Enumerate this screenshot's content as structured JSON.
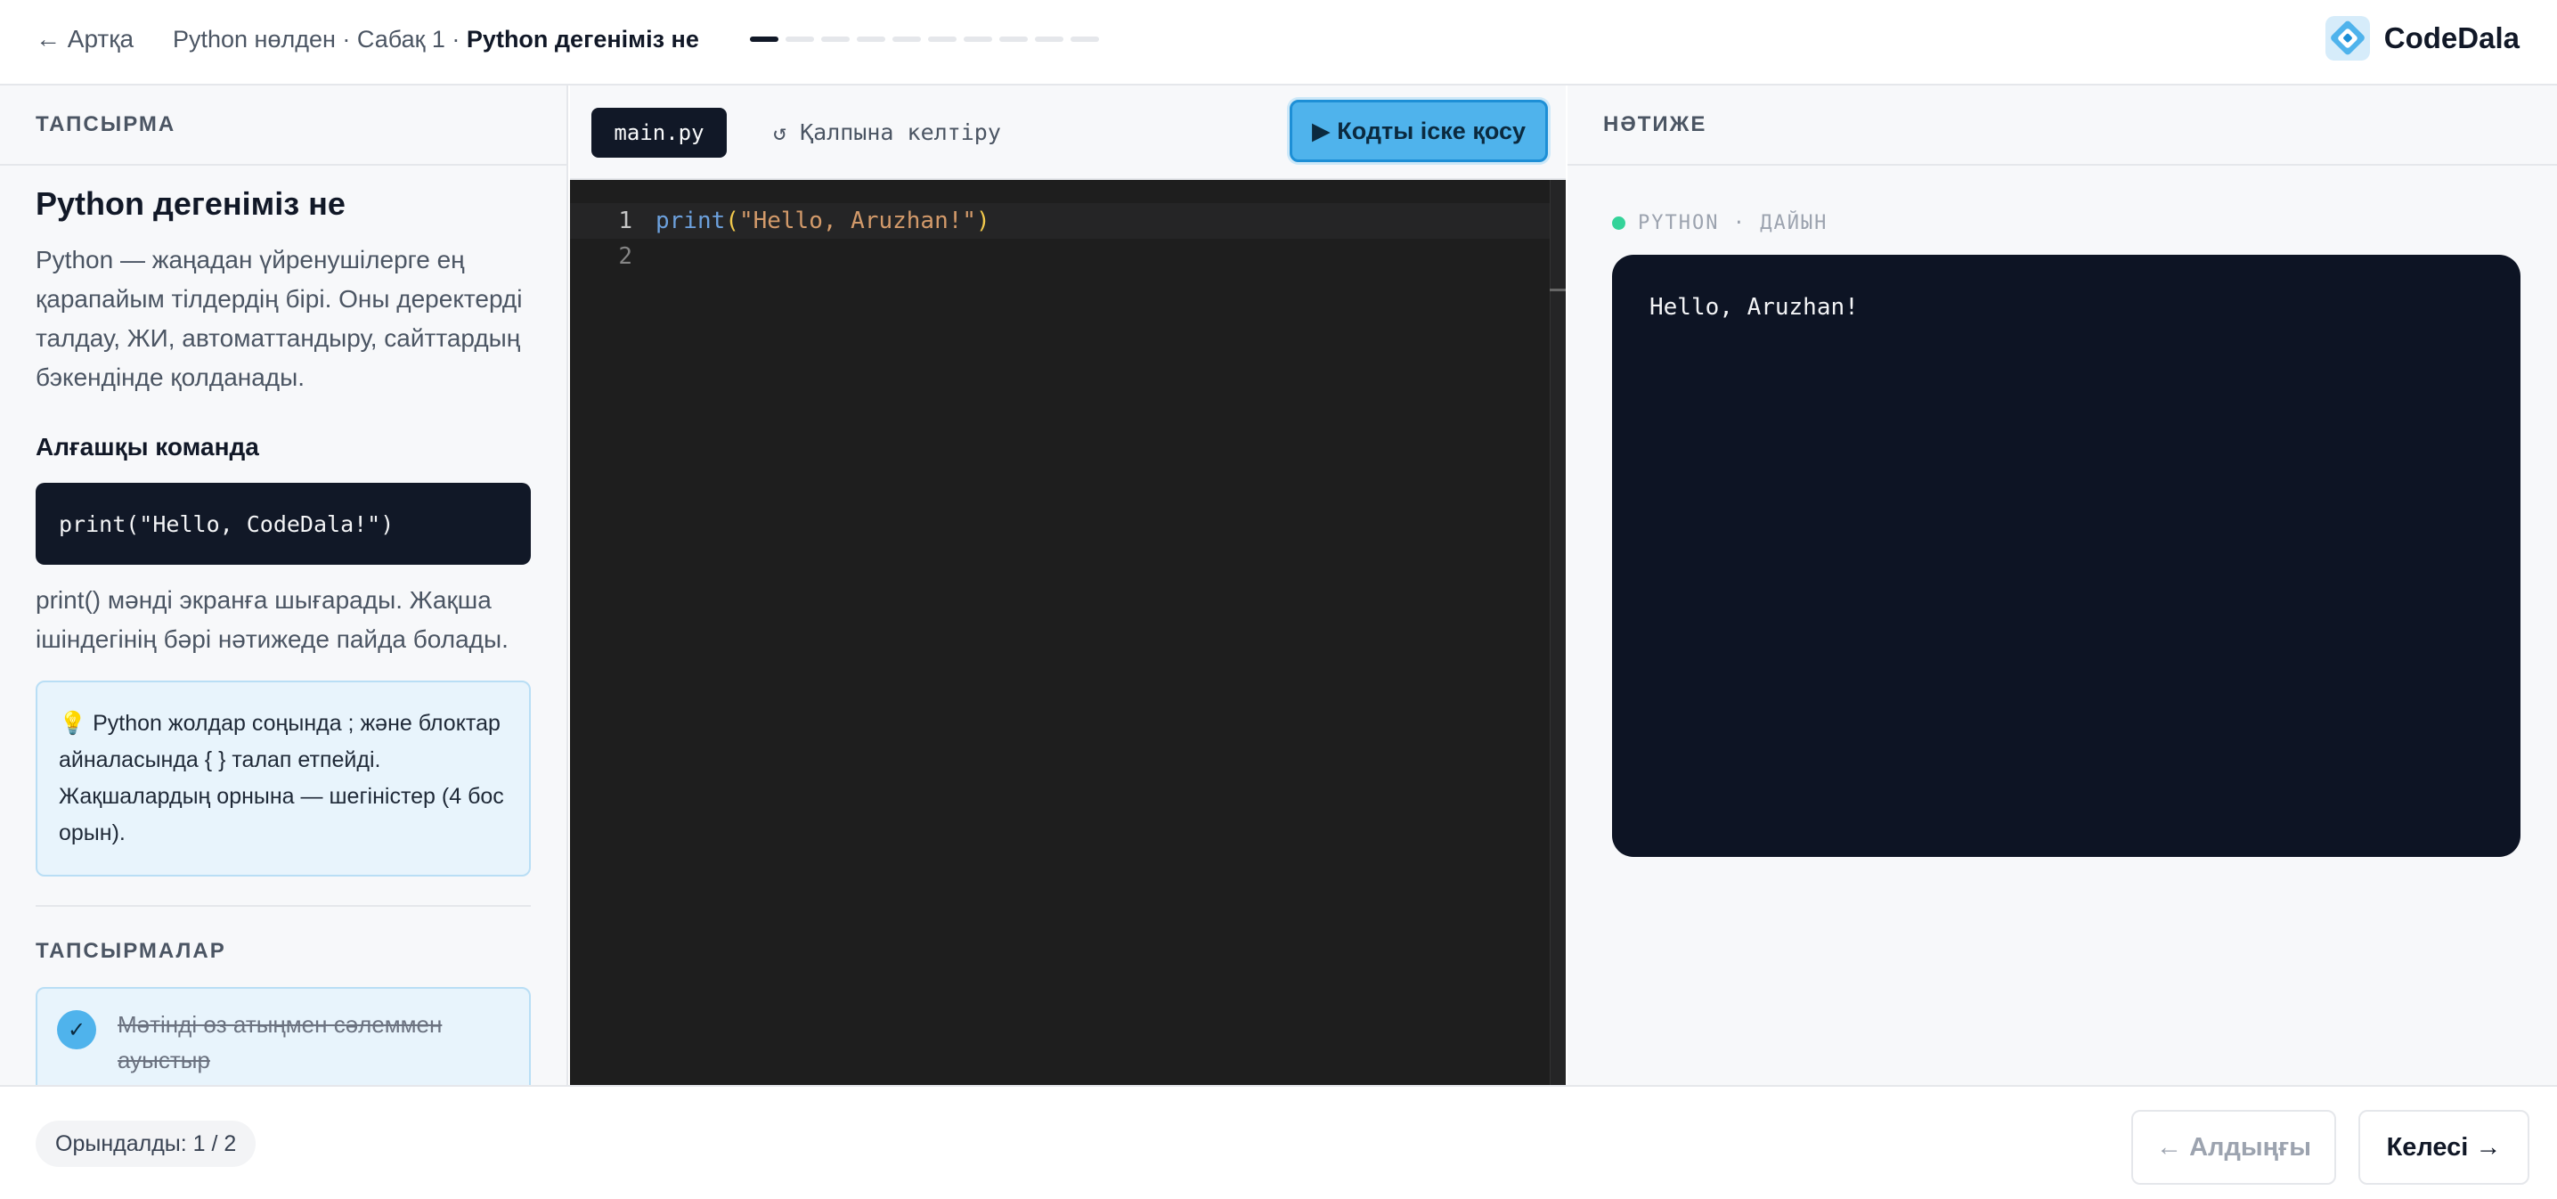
{
  "header": {
    "back_label": "← Артқа",
    "breadcrumb_prefix": "Python нөлден · Сабақ 1 · ",
    "breadcrumb_current": "Python дегеніміз не",
    "progress": {
      "current": 1,
      "total": 10
    },
    "logo_text": "CodeDala"
  },
  "left": {
    "section_label": "ТАПСЫРМА",
    "title": "Python дегеніміз не",
    "intro": "Python — жаңадан үйренушілерге ең қарапайым тілдердің бірі. Оны деректерді талдау, ЖИ, автоматтандыру, сайттардың бэкендінде қолданады.",
    "subheading": "Алғашқы команда",
    "code_example": "print(\"Hello, CodeDala!\")",
    "explanation": "print() мәнді экранға шығарады. Жақша ішіндегінің бәрі нәтижеде пайда болады.",
    "tip": "💡 Python жолдар соңында ; және блоктар айналасында { } талап етпейді. Жақшалардың орнына — шегіністер (4 бос орын).",
    "tasks_label": "ТАПСЫРМАЛАР",
    "tasks": [
      {
        "label": "Мәтінді өз атыңмен сәлеммен ауыстыр",
        "done": true
      }
    ]
  },
  "editor": {
    "file_tab": "main.py",
    "reset_label": "↺ Қалпына келтіру",
    "run_label": "▶ Кодты іске қосу",
    "lines": [
      {
        "num": "1",
        "fn": "print",
        "open": "(",
        "str": "\"Hello, Aruzhan!\"",
        "close": ")"
      },
      {
        "num": "2"
      }
    ]
  },
  "result": {
    "section_label": "НӘТИЖЕ",
    "status": "PYTHON · ДАЙЫН",
    "output": "Hello, Aruzhan!"
  },
  "footer": {
    "done": "Орындалды: 1 / 2",
    "prev_label": "← Алдыңғы",
    "next_label": "Келесі →"
  },
  "colors": {
    "accent": "#4fb3ec",
    "dark": "#111827",
    "console_bg": "#0d1424",
    "status_ok": "#34d399"
  }
}
